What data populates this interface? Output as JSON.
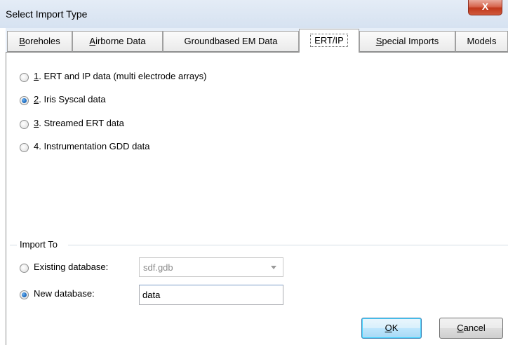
{
  "window": {
    "title": "Select Import Type",
    "close_glyph": "X"
  },
  "tabs": [
    {
      "key": "B",
      "rest": "oreholes"
    },
    {
      "key": "A",
      "rest": "irborne Data"
    },
    {
      "label": "Groundbased EM Data"
    },
    {
      "label": "ERT/IP"
    },
    {
      "key": "S",
      "rest": "pecial Imports"
    },
    {
      "label": "Models"
    }
  ],
  "active_tab": "ERT/IP",
  "import_types": [
    {
      "key": "1",
      "rest": ". ERT and IP data (multi electrode arrays)",
      "checked": false
    },
    {
      "key": "2",
      "rest": ". Iris Syscal data",
      "checked": true
    },
    {
      "key": "3",
      "rest": ". Streamed ERT data",
      "checked": false
    },
    {
      "prefix": "4. Instrumentation GDD data",
      "checked": false
    }
  ],
  "import_to": {
    "group_label": "Import To",
    "existing_label": "Existing database:",
    "existing_value": "sdf.gdb",
    "new_label": "New database:",
    "new_value": "data",
    "selected": "new"
  },
  "buttons": {
    "ok_key": "O",
    "ok_rest": "K",
    "cancel_key": "C",
    "cancel_rest": "ancel"
  }
}
